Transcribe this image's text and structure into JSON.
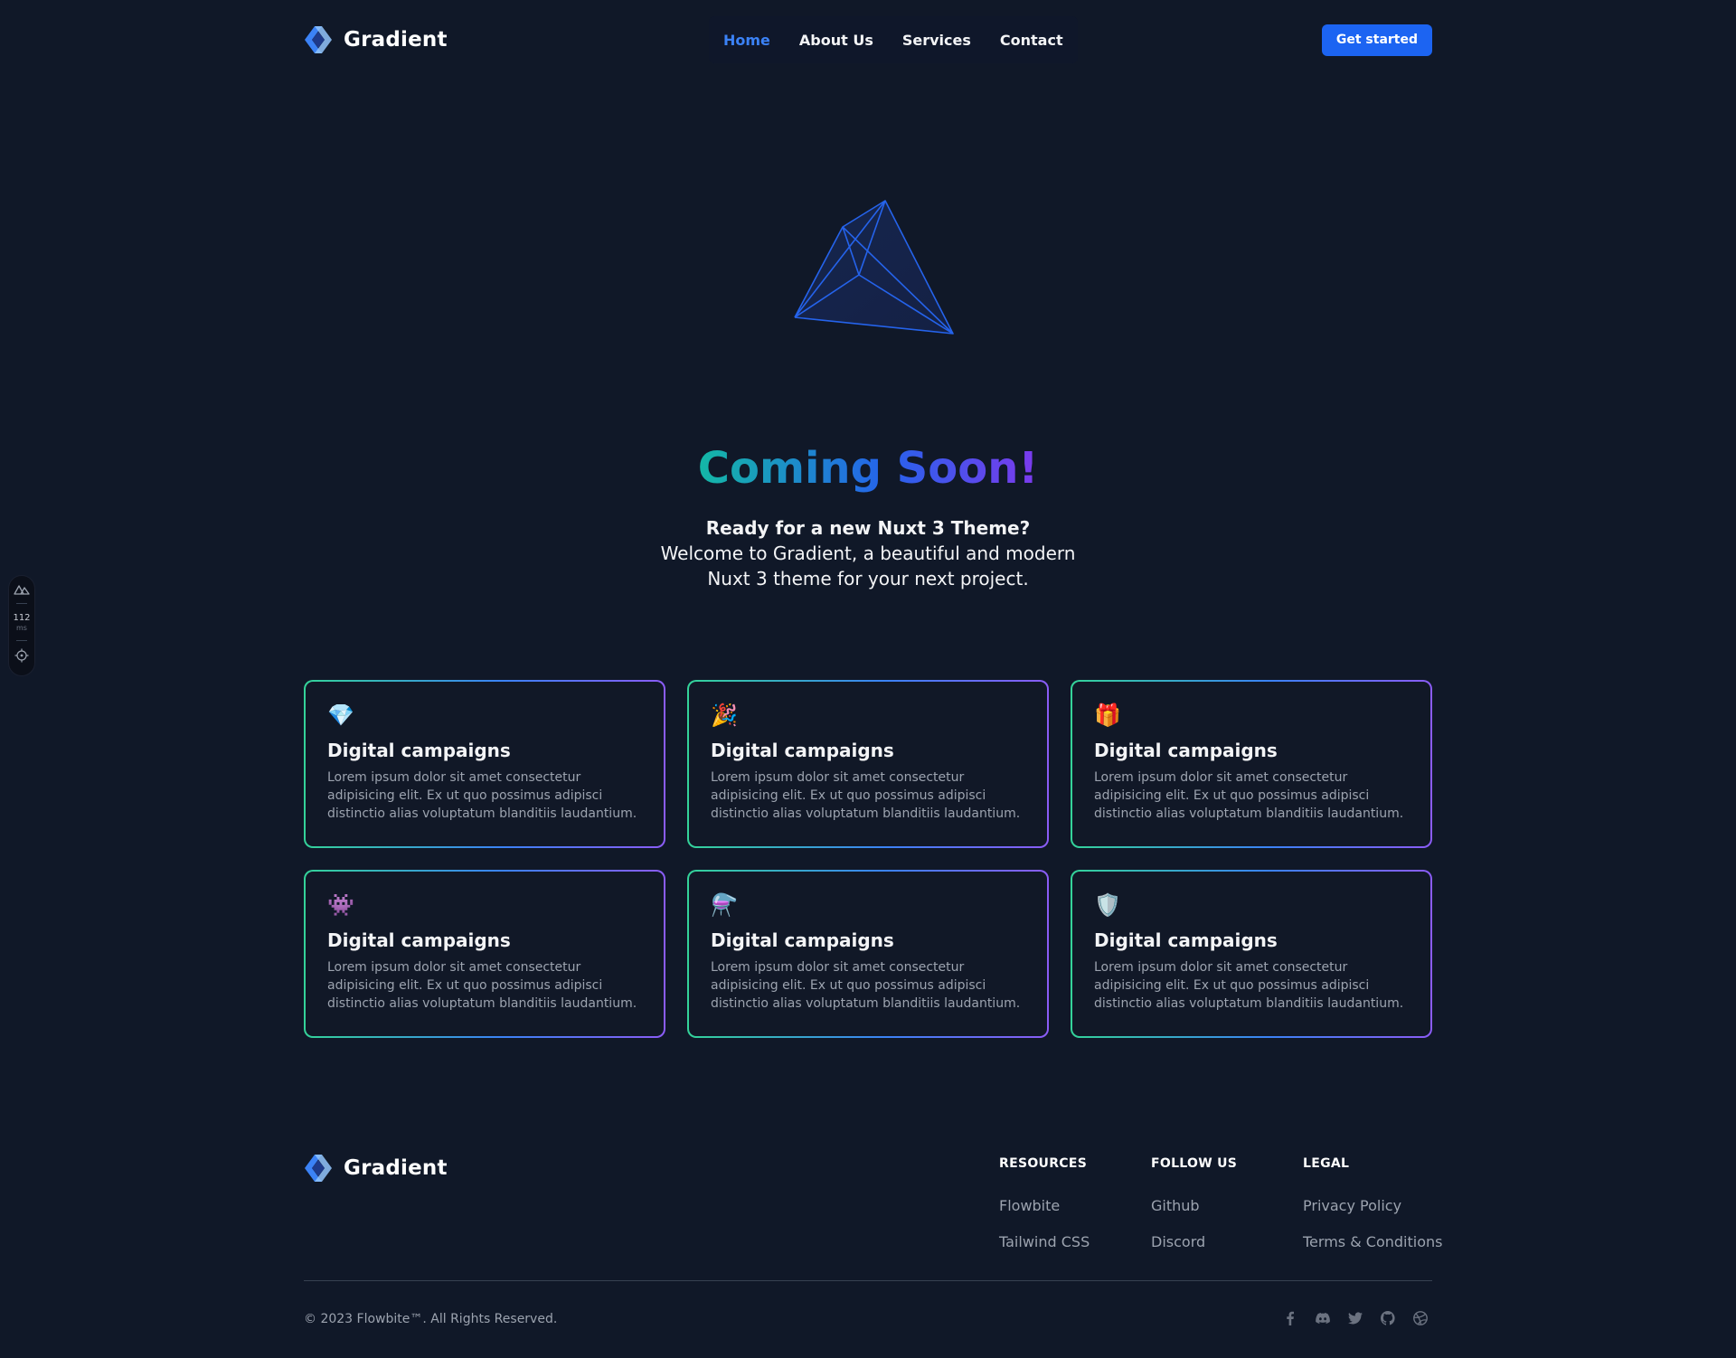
{
  "brand": {
    "name": "Gradient"
  },
  "nav": {
    "links": [
      "Home",
      "About Us",
      "Services",
      "Contact"
    ],
    "active_index": 0,
    "cta_label": "Get started"
  },
  "hero": {
    "title": "Coming Soon!",
    "lead": "Ready for a new Nuxt 3 Theme?",
    "line1": "Welcome to Gradient, a beautiful and modern",
    "line2": "Nuxt 3 theme for your next project."
  },
  "devtool": {
    "value": "112",
    "unit": "ms"
  },
  "cards": [
    {
      "icon": "💎",
      "icon_name": "gem-icon",
      "title": "Digital campaigns",
      "text": "Lorem ipsum dolor sit amet consectetur adipisicing elit. Ex ut quo possimus adipisci distinctio alias voluptatum blanditiis laudantium."
    },
    {
      "icon": "🎉",
      "icon_name": "party-popper-icon",
      "title": "Digital campaigns",
      "text": "Lorem ipsum dolor sit amet consectetur adipisicing elit. Ex ut quo possimus adipisci distinctio alias voluptatum blanditiis laudantium."
    },
    {
      "icon": "🎁",
      "icon_name": "gift-icon",
      "title": "Digital campaigns",
      "text": "Lorem ipsum dolor sit amet consectetur adipisicing elit. Ex ut quo possimus adipisci distinctio alias voluptatum blanditiis laudantium."
    },
    {
      "icon": "👾",
      "icon_name": "alien-monster-icon",
      "title": "Digital campaigns",
      "text": "Lorem ipsum dolor sit amet consectetur adipisicing elit. Ex ut quo possimus adipisci distinctio alias voluptatum blanditiis laudantium."
    },
    {
      "icon": "⚗️",
      "icon_name": "alembic-icon",
      "title": "Digital campaigns",
      "text": "Lorem ipsum dolor sit amet consectetur adipisicing elit. Ex ut quo possimus adipisci distinctio alias voluptatum blanditiis laudantium."
    },
    {
      "icon": "🛡️",
      "icon_name": "shield-icon",
      "title": "Digital campaigns",
      "text": "Lorem ipsum dolor sit amet consectetur adipisicing elit. Ex ut quo possimus adipisci distinctio alias voluptatum blanditiis laudantium."
    }
  ],
  "footer": {
    "columns": [
      {
        "heading": "RESOURCES",
        "links": [
          "Flowbite",
          "Tailwind CSS"
        ]
      },
      {
        "heading": "FOLLOW US",
        "links": [
          "Github",
          "Discord"
        ]
      },
      {
        "heading": "LEGAL",
        "links": [
          "Privacy Policy",
          "Terms & Conditions"
        ]
      }
    ],
    "copyright": "© 2023 Flowbite™. All Rights Reserved.",
    "socials": [
      "facebook-icon",
      "discord-icon",
      "twitter-icon",
      "github-icon",
      "dribbble-icon"
    ]
  },
  "colors": {
    "background": "#101828",
    "accent": "#1c64f2",
    "active_link": "#3b82f6",
    "gradient_start": "#14b8a6",
    "gradient_mid": "#2563eb",
    "gradient_end": "#7c3aed"
  }
}
